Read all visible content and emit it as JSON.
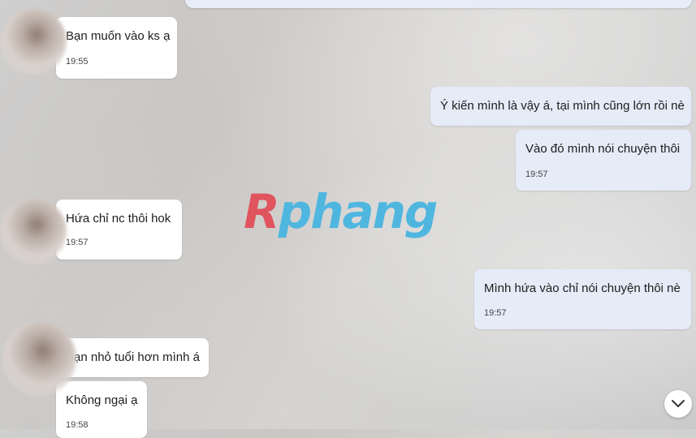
{
  "logo": {
    "first": "R",
    "rest": "phang"
  },
  "messages": [
    {
      "text": "Bạn muốn vào ks ạ",
      "time": "19:55"
    },
    {
      "text": "Ý kiến mình là vậy á, tại mình cũng lớn rồi nè"
    },
    {
      "text": "Vào đó mình nói chuyện thôi",
      "time": "19:57"
    },
    {
      "text": "Hứa chỉ nc thôi hok",
      "time": "19:57"
    },
    {
      "text": "Mình hứa vào chỉ nói chuyện thôi nè",
      "time": "19:57"
    },
    {
      "text": "Bạn nhỏ tuổi hơn mình á"
    },
    {
      "text": "Không ngại ạ",
      "time": "19:58"
    }
  ],
  "icons": {
    "scroll_down": "chevron-down-icon"
  }
}
